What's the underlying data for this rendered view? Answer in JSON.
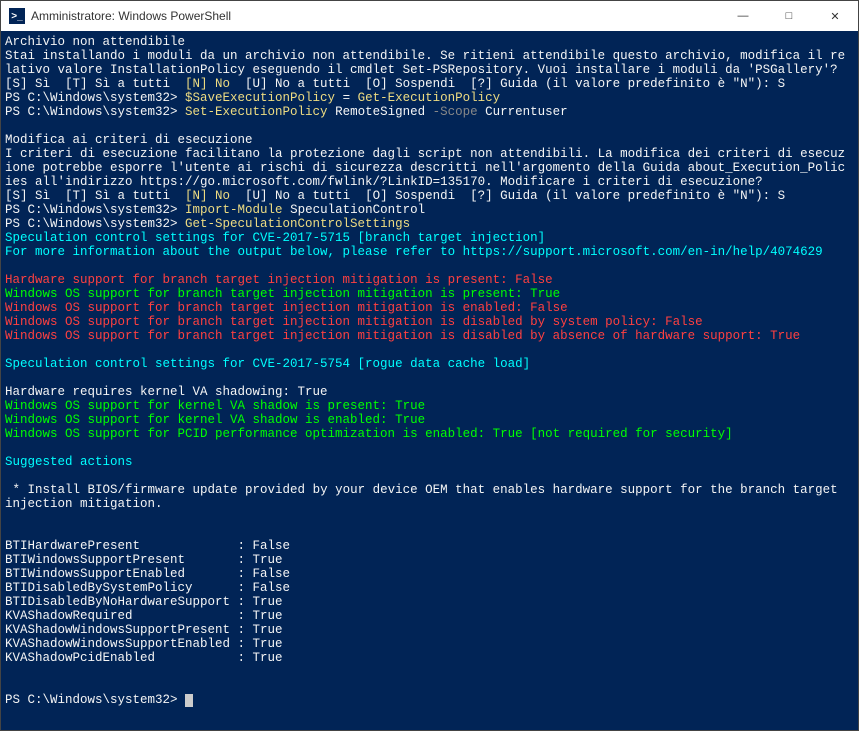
{
  "titlebar": {
    "icon_label": ">_",
    "title": "Amministratore: Windows PowerShell"
  },
  "lines": {
    "l01": "Archivio non attendibile",
    "l02": "Stai installando i moduli da un archivio non attendibile. Se ritieni attendibile questo archivio, modifica il relativo valore InstallationPolicy eseguendo il cmdlet Set-PSRepository. Vuoi installare i moduli da 'PSGallery'?",
    "l03a": "[S] Sì  [T] Sì a tutti  ",
    "l03b": "[N] No",
    "l03c": "  [U] No a tutti  [O] Sospendi  [?] Guida (il valore predefinito è \"N\"): S",
    "l04a": "PS C:\\Windows\\system32> ",
    "l04b": "$SaveExecutionPolicy",
    "l04c": " = ",
    "l04d": "Get-ExecutionPolicy",
    "l05a": "PS C:\\Windows\\system32> ",
    "l05b": "Set-ExecutionPolicy",
    "l05c": " RemoteSigned ",
    "l05d": "-Scope",
    "l05e": " Currentuser",
    "l06": "Modifica ai criteri di esecuzione",
    "l07": "I criteri di esecuzione facilitano la protezione dagli script non attendibili. La modifica dei criteri di esecuzione potrebbe esporre l'utente ai rischi di sicurezza descritti nell'argomento della Guida about_Execution_Policies all'indirizzo https://go.microsoft.com/fwlink/?LinkID=135170. Modificare i criteri di esecuzione?",
    "l08a": "[S] Sì  [T] Sì a tutti  ",
    "l08b": "[N] No",
    "l08c": "  [U] No a tutti  [O] Sospendi  [?] Guida (il valore predefinito è \"N\"): S",
    "l09a": "PS C:\\Windows\\system32> ",
    "l09b": "Import-Module",
    "l09c": " SpeculationControl",
    "l10a": "PS C:\\Windows\\system32> ",
    "l10b": "Get-SpeculationControlSettings",
    "l11": "Speculation control settings for CVE-2017-5715 [branch target injection]",
    "l12": "For more information about the output below, please refer to https://support.microsoft.com/en-in/help/4074629",
    "l13": "Hardware support for branch target injection mitigation is present: False",
    "l14": "Windows OS support for branch target injection mitigation is present: True",
    "l15": "Windows OS support for branch target injection mitigation is enabled: False",
    "l16": "Windows OS support for branch target injection mitigation is disabled by system policy: False",
    "l17": "Windows OS support for branch target injection mitigation is disabled by absence of hardware support: True",
    "l18": "Speculation control settings for CVE-2017-5754 [rogue data cache load]",
    "l19": "Hardware requires kernel VA shadowing: True",
    "l20": "Windows OS support for kernel VA shadow is present: True",
    "l21": "Windows OS support for kernel VA shadow is enabled: True",
    "l22": "Windows OS support for PCID performance optimization is enabled: True [not required for security]",
    "l23": "Suggested actions",
    "l24": " * Install BIOS/firmware update provided by your device OEM that enables hardware support for the branch target injection mitigation.",
    "t1": "BTIHardwarePresent             : False",
    "t2": "BTIWindowsSupportPresent       : True",
    "t3": "BTIWindowsSupportEnabled       : False",
    "t4": "BTIDisabledBySystemPolicy      : False",
    "t5": "BTIDisabledByNoHardwareSupport : True",
    "t6": "KVAShadowRequired              : True",
    "t7": "KVAShadowWindowsSupportPresent : True",
    "t8": "KVAShadowWindowsSupportEnabled : True",
    "t9": "KVAShadowPcidEnabled           : True",
    "prompt": "PS C:\\Windows\\system32> "
  }
}
